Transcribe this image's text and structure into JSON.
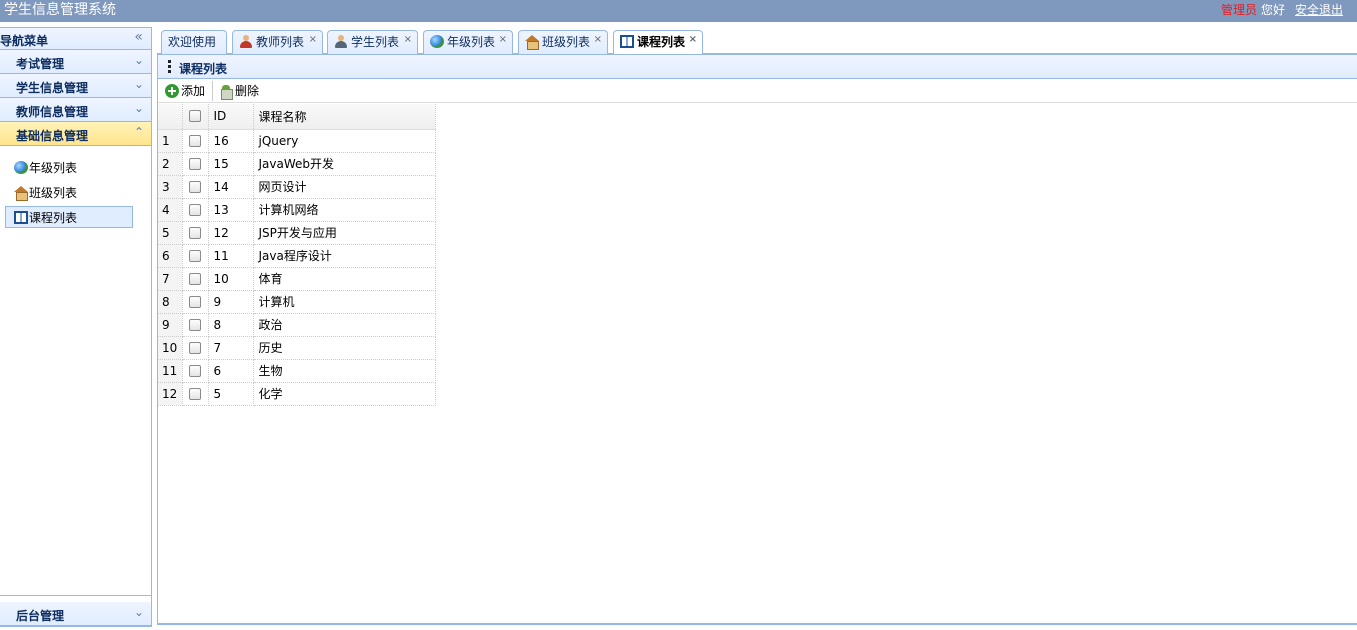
{
  "header": {
    "title": "学生信息管理系统",
    "admin": "管理员",
    "greeting": "您好",
    "logout": "安全退出"
  },
  "sidebar": {
    "title": "导航菜单",
    "sections": [
      {
        "label": "考试管理"
      },
      {
        "label": "学生信息管理"
      },
      {
        "label": "教师信息管理"
      },
      {
        "label": "基础信息管理"
      }
    ],
    "items": [
      {
        "label": "年级列表",
        "icon": "globe-icon"
      },
      {
        "label": "班级列表",
        "icon": "house-icon"
      },
      {
        "label": "课程列表",
        "icon": "book-icon"
      }
    ],
    "bottom_section": {
      "label": "后台管理"
    }
  },
  "tabs": [
    {
      "label": "欢迎使用",
      "closable": false
    },
    {
      "label": "教师列表",
      "icon": "teacher-icon",
      "closable": true
    },
    {
      "label": "学生列表",
      "icon": "student-icon",
      "closable": true
    },
    {
      "label": "年级列表",
      "icon": "globe-icon",
      "closable": true
    },
    {
      "label": "班级列表",
      "icon": "house-icon",
      "closable": true
    },
    {
      "label": "课程列表",
      "icon": "book-icon",
      "closable": true,
      "active": true
    }
  ],
  "panel": {
    "title": "课程列表",
    "toolbar": {
      "add": "添加",
      "delete": "删除"
    },
    "columns": {
      "id": "ID",
      "name": "课程名称"
    },
    "rows": [
      {
        "num": "1",
        "id": "16",
        "name": "jQuery"
      },
      {
        "num": "2",
        "id": "15",
        "name": "JavaWeb开发"
      },
      {
        "num": "3",
        "id": "14",
        "name": "网页设计"
      },
      {
        "num": "4",
        "id": "13",
        "name": "计算机网络"
      },
      {
        "num": "5",
        "id": "12",
        "name": "JSP开发与应用"
      },
      {
        "num": "6",
        "id": "11",
        "name": "Java程序设计"
      },
      {
        "num": "7",
        "id": "10",
        "name": "体育"
      },
      {
        "num": "8",
        "id": "9",
        "name": "计算机"
      },
      {
        "num": "9",
        "id": "8",
        "name": "政治"
      },
      {
        "num": "10",
        "id": "7",
        "name": "历史"
      },
      {
        "num": "11",
        "id": "6",
        "name": "生物"
      },
      {
        "num": "12",
        "id": "5",
        "name": "化学"
      }
    ]
  },
  "colors": {
    "header_bg": "#7f99be",
    "admin_red": "#e41d1d",
    "border_blue": "#95b8e7",
    "active_section": "#ffe48d"
  }
}
